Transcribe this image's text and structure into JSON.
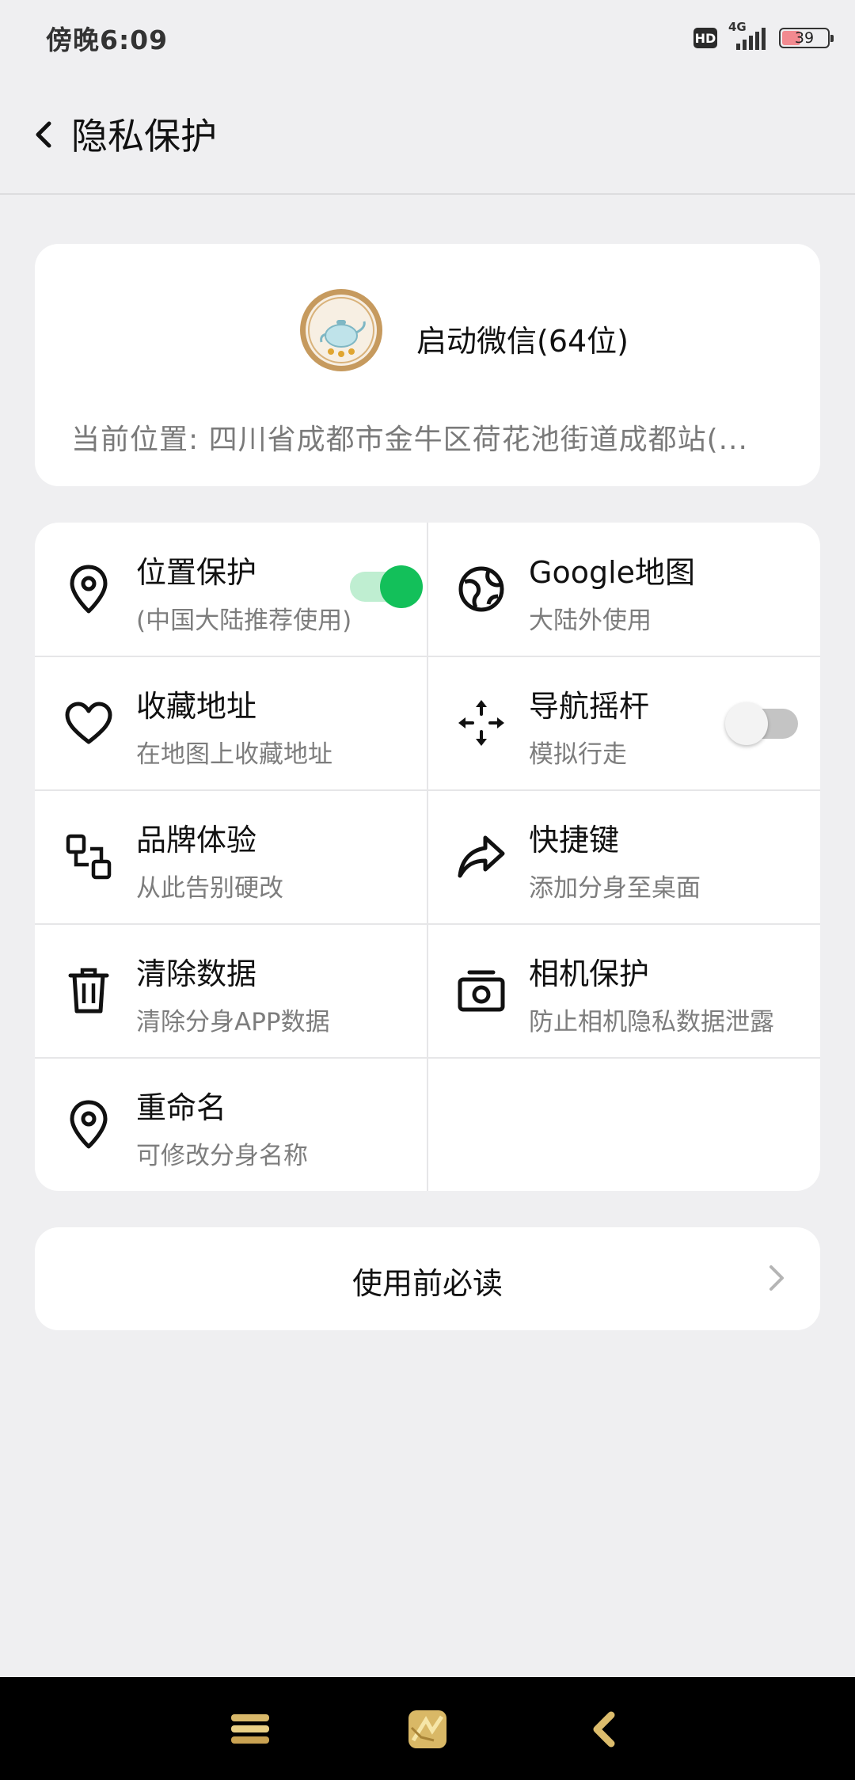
{
  "status_bar": {
    "time": "傍晚6:09",
    "hd": "HD",
    "network": "4G",
    "battery_level": "39"
  },
  "header": {
    "title": "隐私保护"
  },
  "app_card": {
    "name": "启动微信(64位)",
    "location": "当前位置: 四川省成都市金牛区荷花池街道成都站(..."
  },
  "features": [
    {
      "title": "位置保护",
      "subtitle": "(中国大陆推荐使用)",
      "icon": "location-pin-icon",
      "toggle": "on"
    },
    {
      "title": "Google地图",
      "subtitle": "大陆外使用",
      "icon": "globe-icon"
    },
    {
      "title": "收藏地址",
      "subtitle": "在地图上收藏地址",
      "icon": "heart-icon"
    },
    {
      "title": "导航摇杆",
      "subtitle": "模拟行走",
      "icon": "move-arrows-icon",
      "toggle": "off"
    },
    {
      "title": "品牌体验",
      "subtitle": "从此告别硬改",
      "icon": "swap-squares-icon"
    },
    {
      "title": "快捷键",
      "subtitle": "添加分身至桌面",
      "icon": "share-arrow-icon"
    },
    {
      "title": "清除数据",
      "subtitle": "清除分身APP数据",
      "icon": "trash-icon"
    },
    {
      "title": "相机保护",
      "subtitle": "防止相机隐私数据泄露",
      "icon": "camera-icon"
    },
    {
      "title": "重命名",
      "subtitle": "可修改分身名称",
      "icon": "location-pin-icon"
    }
  ],
  "read_before": {
    "label": "使用前必读"
  },
  "colors": {
    "accent_green": "#13c05a",
    "toggle_on_track": "#bfeed1",
    "toggle_off_track": "#c4c4c4",
    "page_background": "#efeff1"
  }
}
